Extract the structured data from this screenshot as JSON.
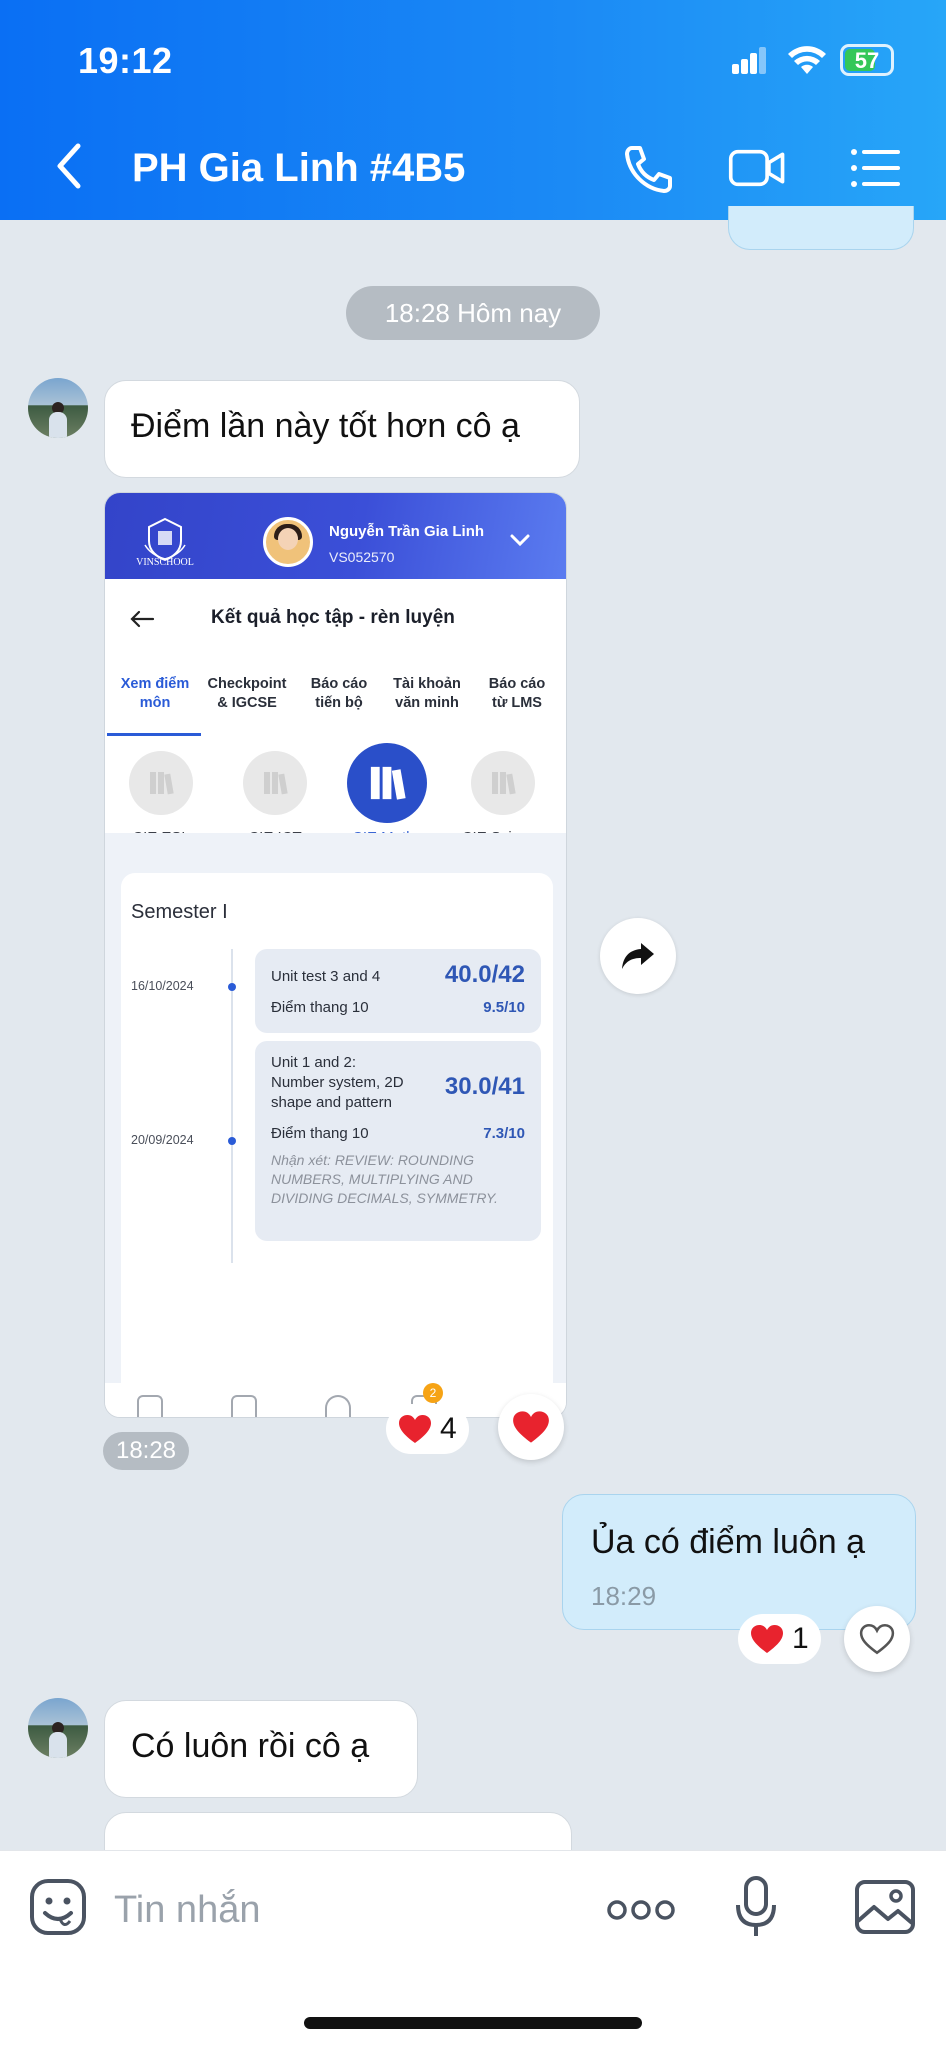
{
  "status_bar": {
    "time": "19:12",
    "battery": "57"
  },
  "header": {
    "title": "PH Gia Linh #4B5"
  },
  "chat": {
    "date_label": "18:28 Hôm nay",
    "messages": [
      {
        "text": "Điểm lần này tốt hơn cô ạ"
      },
      {
        "time": "18:28",
        "reaction_count": "4"
      },
      {
        "text": "Ủa có điểm luôn ạ",
        "time": "18:29",
        "reaction_count": "1"
      },
      {
        "text": "Có luôn rồi cô ạ"
      }
    ]
  },
  "screenshot": {
    "logo_text": "VINSCHOOL",
    "student_name": "Nguyễn Trần Gia Linh",
    "student_id": "VS052570",
    "page_title": "Kết quả học tập - rèn luyện",
    "tabs": [
      "Xem điểm\nmôn",
      "Checkpoint\n& IGCSE",
      "Báo cáo\ntiến bộ",
      "Tài khoản\nvăn minh",
      "Báo cáo\ntừ LMS"
    ],
    "subjects": [
      "CIE ESL",
      "CIE ICT",
      "CIE Maths",
      "CIE Science"
    ],
    "semester": "Semester I",
    "entries": [
      {
        "date": "16/10/2024",
        "name": "Unit test 3 and 4",
        "score": "40.0/42",
        "month_label": "Điểm thang 10",
        "month_score": "9.5/10"
      },
      {
        "date": "20/09/2024",
        "name": "Unit 1 and 2:\nNumber system, 2D\nshape and pattern",
        "score": "30.0/41",
        "month_label": "Điểm thang 10",
        "month_score": "7.3/10",
        "note": "Nhận xét: REVIEW: ROUNDING NUMBERS, MULTIPLYING AND DIVIDING DECIMALS, SYMMETRY."
      }
    ],
    "nav_badge": "2"
  },
  "input": {
    "placeholder": "Tin nhắn"
  },
  "colors": {
    "header_start": "#0a6ff4",
    "header_end": "#27a6f8",
    "outgoing_bubble": "#d2ecfb",
    "accent": "#2a5bd7",
    "heart": "#e8232e"
  }
}
